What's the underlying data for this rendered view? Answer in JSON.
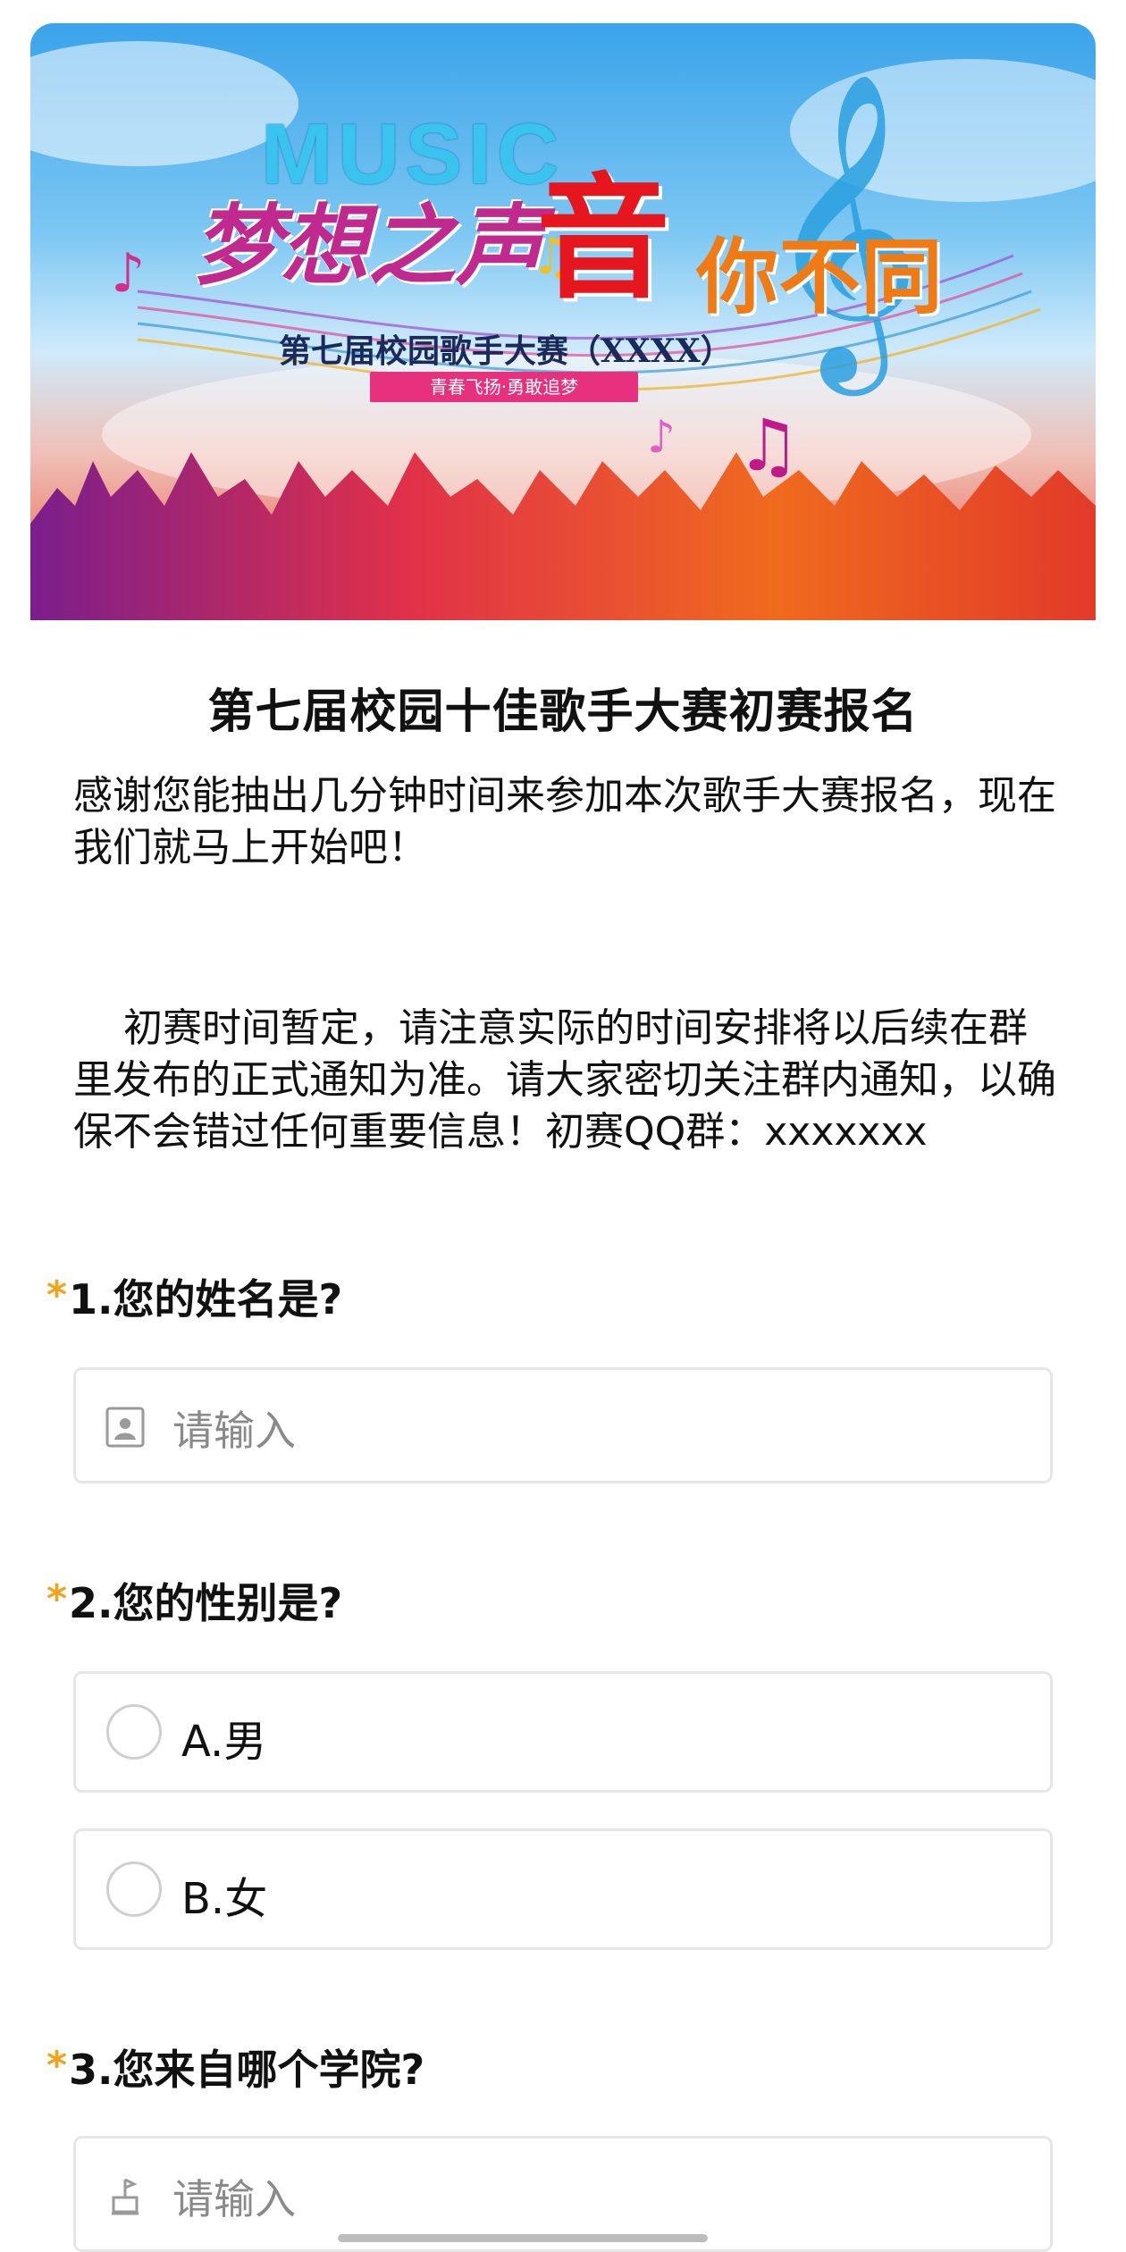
{
  "banner": {
    "music_word": "MUSIC",
    "dream_word": "梦想之声",
    "sound_word": "音",
    "different_word": "你不同",
    "subtitle": "第七届校园歌手大赛（XXXX）",
    "tagline": "青春飞扬·勇敢追梦"
  },
  "page": {
    "title": "第七届校园十佳歌手大赛初赛报名",
    "intro": "感谢您能抽出几分钟时间来参加本次歌手大赛报名，现在我们就马上开始吧！",
    "notice": "初赛时间暂定，请注意实际的时间安排将以后续在群里发布的正式通知为准。请大家密切关注群内通知，以确保不会错过任何重要信息！初赛QQ群：xxxxxxx"
  },
  "questions": [
    {
      "required_mark": "*",
      "label": "1.您的姓名是?",
      "placeholder": "请输入",
      "icon": "contact-card-icon"
    },
    {
      "required_mark": "*",
      "label": "2.您的性别是?",
      "options": [
        "A.男",
        "B.女"
      ]
    },
    {
      "required_mark": "*",
      "label": "3.您来自哪个学院?",
      "placeholder": "请输入",
      "icon": "building-icon"
    }
  ],
  "colors": {
    "required_star": "#f3a31b",
    "field_border": "#e6e6e6",
    "placeholder": "#8a8a8a"
  }
}
